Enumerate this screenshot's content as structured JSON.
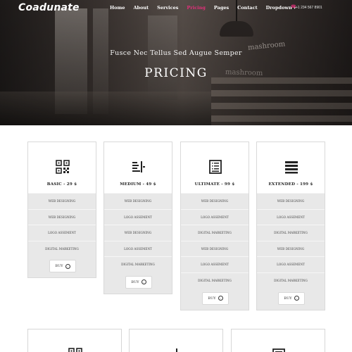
{
  "brand": {
    "logo": "Coadunate",
    "accent": "#e2307a"
  },
  "nav": {
    "items": [
      {
        "label": "Home",
        "active": false
      },
      {
        "label": "About",
        "active": false
      },
      {
        "label": "Services",
        "active": false
      },
      {
        "label": "Pricing",
        "active": true
      },
      {
        "label": "Pages",
        "active": false
      },
      {
        "label": "Contact",
        "active": false
      },
      {
        "label": "Dropdown",
        "active": false,
        "suffix": "▾"
      }
    ],
    "phone": "+1 234 567 8901",
    "phone_icon": "phone-icon"
  },
  "hero": {
    "subtitle": "Fusce Nec Tellus Sed Augue Semper",
    "title": "PRICING",
    "sign_text": "mashroom"
  },
  "plans": [
    {
      "name": "BASIC - 29 $",
      "icon": "qr-code-icon",
      "features": [
        "WEB DESIGNING",
        "WEB DESIGNING",
        "LOGO ASSEMENT",
        "DIGITAL MARKETING"
      ],
      "buy": "BUY"
    },
    {
      "name": "MEDIUM - 49 $",
      "icon": "text-cursor-icon",
      "features": [
        "WEB DESIGNING",
        "LOGO ASSEMENT",
        "WEB DESIGNING",
        "LOGO ASSEMENT",
        "DIGITAL MARKETING"
      ],
      "buy": "BUY"
    },
    {
      "name": "ULTIMATE - 99 $",
      "icon": "list-document-icon",
      "features": [
        "WEB DESIGNING",
        "LOGO ASSEMENT",
        "DIGITAL MARKETING",
        "WEB DESIGNING",
        "LOGO ASSEMENT",
        "DIGITAL MARKETING"
      ],
      "buy": "BUY"
    },
    {
      "name": "EXTENDED - 199 $",
      "icon": "menu-lines-icon",
      "features": [
        "WEB DESIGNING",
        "LOGO ASSEMENT",
        "DIGITAL MARKETING",
        "WEB DESIGNING",
        "LOGO ASSEMENT",
        "DIGITAL MARKETING"
      ],
      "buy": "BUY"
    }
  ],
  "second_row_icons": [
    "qr-code-icon",
    "text-cursor-icon",
    "list-document-icon"
  ]
}
